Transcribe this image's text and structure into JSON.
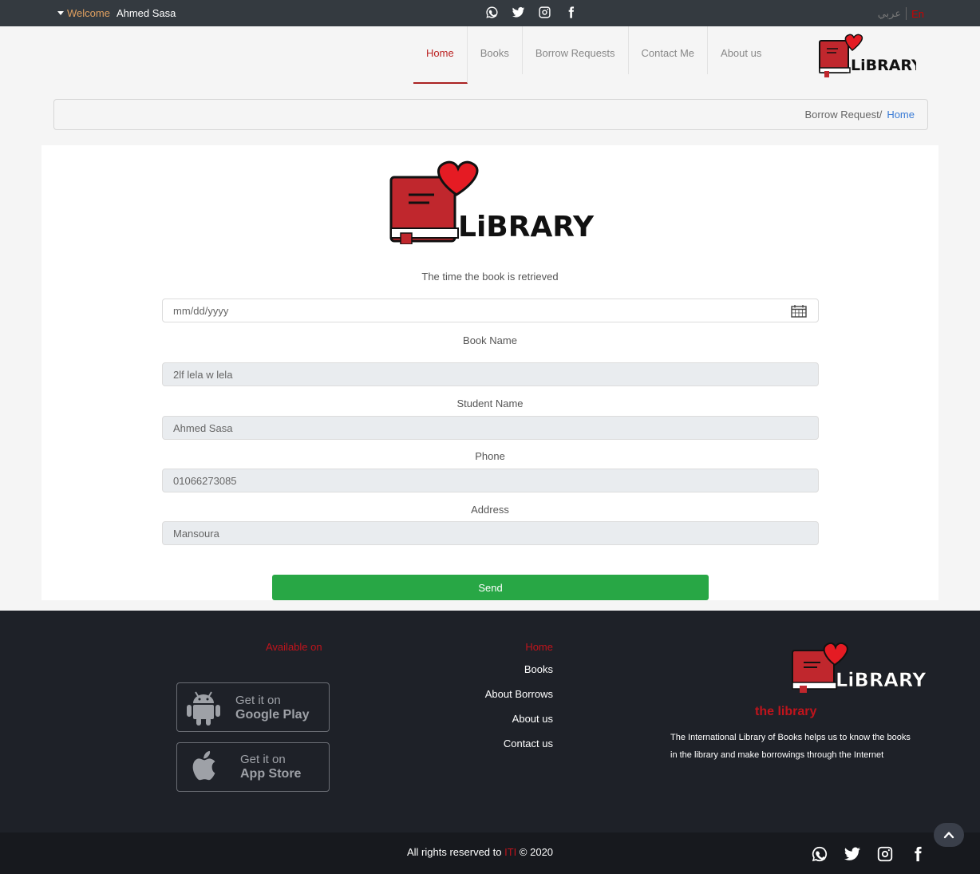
{
  "topbar": {
    "welcome": "Welcome",
    "user": "Ahmed Sasa",
    "lang_ar": "عربي",
    "lang_en": "En",
    "social": [
      "whatsapp-icon",
      "twitter-icon",
      "instagram-icon",
      "facebook-icon"
    ]
  },
  "nav": {
    "items": [
      {
        "label": "Home",
        "active": true
      },
      {
        "label": "Books"
      },
      {
        "label": "Borrow Requests"
      },
      {
        "label": "Contact Me"
      },
      {
        "label": "About us"
      }
    ],
    "logo_text": "LiBRARY"
  },
  "breadcrumb": {
    "current": "Borrow Request/",
    "home": "Home"
  },
  "form": {
    "logo_text": "LiBRARY",
    "date_label": "The time the book is retrieved",
    "date_placeholder": "mm/dd/yyyy",
    "book_label": "Book Name",
    "book_value": "2lf lela w lela",
    "student_label": "Student Name",
    "student_value": "Ahmed Sasa",
    "phone_label": "Phone",
    "phone_value": "01066273085",
    "address_label": "Address",
    "address_value": "Mansoura",
    "send_label": "Send"
  },
  "footer": {
    "available_heading": "Available on",
    "google_small": "Get it on",
    "google_big": "Google Play",
    "apple_small": "Get it on",
    "apple_big": "App Store",
    "links_heading": "Home",
    "links": [
      "Books",
      "About Borrows",
      "About us",
      "Contact us"
    ],
    "logo_text": "LiBRARY",
    "subtitle": "the library",
    "description": "The International Library of Books helps us to know the books in the library and make borrowings through the Internet",
    "copyright_pre": "All rights reserved to",
    "copyright_org": "ITI",
    "copyright_post": "© 2020",
    "accent": "#c0141c"
  },
  "colors": {
    "topbar": "#343a40",
    "accent_red": "#b22222",
    "send_green": "#28a745",
    "footer": "#1e2128"
  }
}
